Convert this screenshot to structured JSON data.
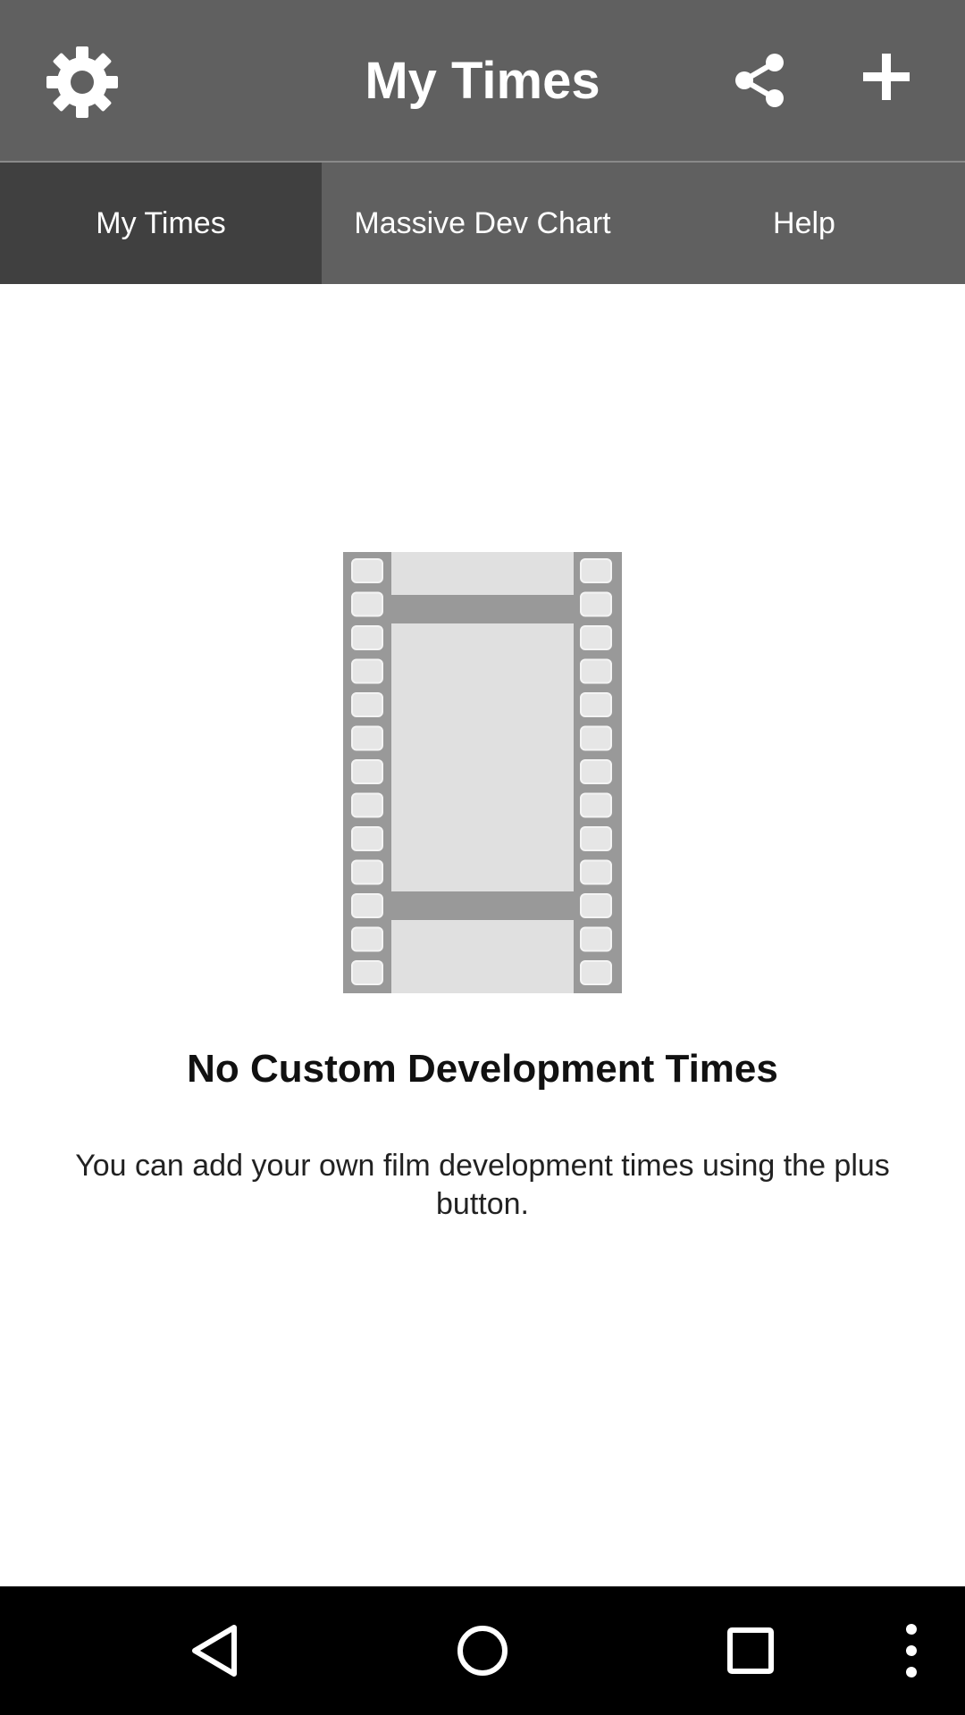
{
  "app": {
    "title": "My Times"
  },
  "toolbar": {
    "settings_icon": "gear-icon",
    "share_icon": "share-icon",
    "add_icon": "plus-icon"
  },
  "tabs": [
    {
      "label": "My Times",
      "active": true
    },
    {
      "label": "Massive Dev Chart",
      "active": false
    },
    {
      "label": "Help",
      "active": false
    }
  ],
  "empty_state": {
    "icon": "film-strip-icon",
    "title": "No Custom Development Times",
    "description": "You can add your own film development times using the plus button."
  },
  "navbar": {
    "back_icon": "back-icon",
    "home_icon": "home-icon",
    "recents_icon": "recents-icon",
    "menu_icon": "overflow-menu-icon"
  },
  "colors": {
    "appbar": "#606060",
    "active_tab": "#404040",
    "background": "#ffffff",
    "navbar": "#000000"
  }
}
